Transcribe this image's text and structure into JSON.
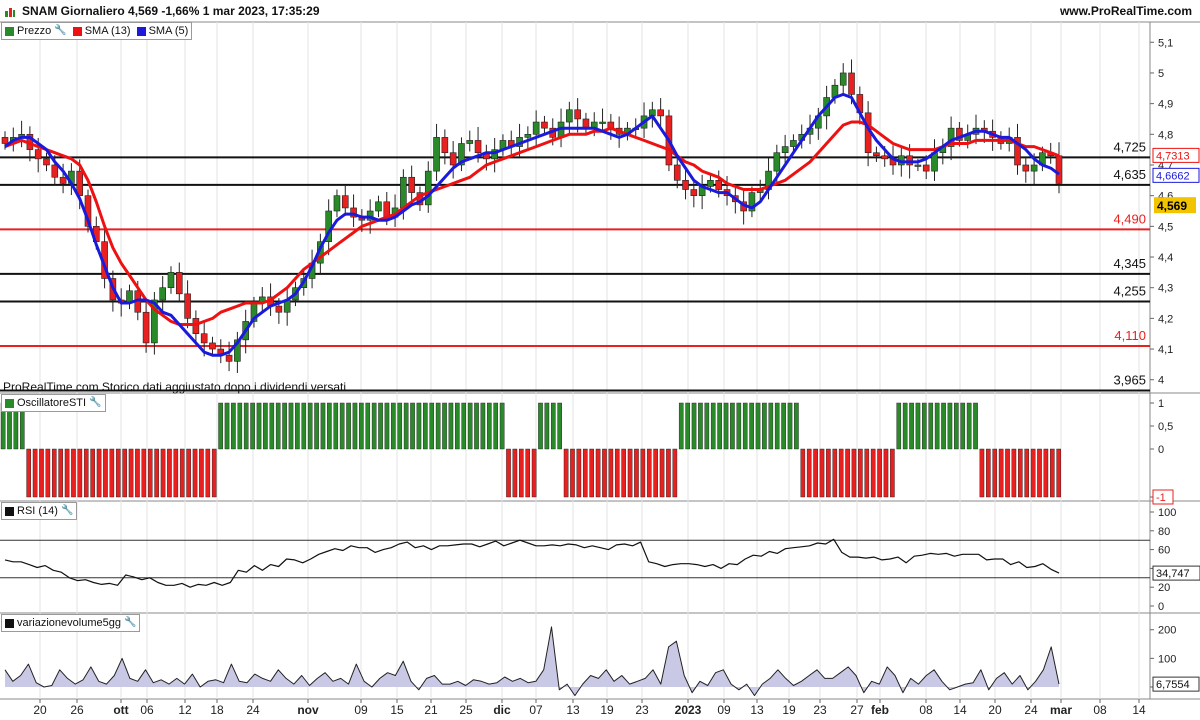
{
  "header": {
    "title": "SNAM Giornaliero 4,569 -1,66% 1 mar 2023, 17:35:29",
    "site": "www.ProRealTime.com"
  },
  "note": "ProRealTime.com Storico dati aggiustato dopo i dividendi versati",
  "legends": {
    "price": "Prezzo",
    "sma13": "SMA (13)",
    "sma5": "SMA (5)",
    "osc": "OscillatoreSTI",
    "rsi": "RSI (14)",
    "vol": "variazionevolume5gg"
  },
  "colors": {
    "up": "#2a8a2a",
    "down": "#e82020",
    "sma13": "#ee1111",
    "sma5": "#1a1adc",
    "volFill": "#c9c9e6"
  },
  "chart_data": [
    {
      "panel": "price",
      "type": "candlestick",
      "y_ticks": [
        "4",
        "4,1",
        "4,2",
        "4,3",
        "4,4",
        "4,5",
        "4,6",
        "4,7",
        "4,8",
        "4,9",
        "5",
        "5,1"
      ],
      "ylim": [
        3.96,
        5.14
      ],
      "x_ticks": [
        "20",
        "26",
        "ott",
        "06",
        "12",
        "18",
        "24",
        "nov",
        "09",
        "15",
        "21",
        "25",
        "dic",
        "07",
        "13",
        "19",
        "23",
        "2023",
        "09",
        "13",
        "19",
        "23",
        "27",
        "feb",
        "08",
        "14",
        "20",
        "24",
        "mar",
        "08",
        "14"
      ],
      "levels": [
        {
          "value": 4.725,
          "label": "4,725",
          "color": "black"
        },
        {
          "value": 4.635,
          "label": "4,635",
          "color": "black"
        },
        {
          "value": 4.49,
          "label": "4,490",
          "color": "red"
        },
        {
          "value": 4.345,
          "label": "4,345",
          "color": "black"
        },
        {
          "value": 4.255,
          "label": "4,255",
          "color": "black"
        },
        {
          "value": 4.11,
          "label": "4,110",
          "color": "red"
        },
        {
          "value": 3.965,
          "label": "3,965",
          "color": "black"
        }
      ],
      "last_values": [
        {
          "label": "4,7313",
          "value": 4.7313,
          "series": "sma13"
        },
        {
          "label": "4,6662",
          "value": 4.6662,
          "series": "sma5"
        },
        {
          "label": "4,569",
          "value": 4.569,
          "series": "price"
        }
      ],
      "close": [
        4.77,
        4.79,
        4.8,
        4.75,
        4.72,
        4.7,
        4.66,
        4.64,
        4.68,
        4.6,
        4.5,
        4.45,
        4.33,
        4.26,
        4.25,
        4.29,
        4.22,
        4.12,
        4.26,
        4.3,
        4.35,
        4.28,
        4.2,
        4.15,
        4.12,
        4.1,
        4.08,
        4.06,
        4.13,
        4.19,
        4.25,
        4.27,
        4.24,
        4.22,
        4.26,
        4.3,
        4.33,
        4.38,
        4.45,
        4.55,
        4.6,
        4.56,
        4.53,
        4.52,
        4.55,
        4.58,
        4.53,
        4.56,
        4.66,
        4.61,
        4.57,
        4.68,
        4.79,
        4.74,
        4.7,
        4.77,
        4.78,
        4.74,
        4.72,
        4.75,
        4.78,
        4.76,
        4.79,
        4.8,
        4.84,
        4.82,
        4.79,
        4.84,
        4.88,
        4.85,
        4.82,
        4.84,
        4.84,
        4.82,
        4.8,
        4.82,
        4.82,
        4.86,
        4.88,
        4.86,
        4.7,
        4.65,
        4.62,
        4.6,
        4.63,
        4.65,
        4.62,
        4.6,
        4.58,
        4.55,
        4.61,
        4.62,
        4.68,
        4.74,
        4.76,
        4.78,
        4.8,
        4.82,
        4.86,
        4.92,
        4.96,
        5.0,
        4.93,
        4.87,
        4.74,
        4.73,
        4.72,
        4.7,
        4.73,
        4.7,
        4.7,
        4.68,
        4.74,
        4.76,
        4.82,
        4.78,
        4.8,
        4.82,
        4.81,
        4.79,
        4.77,
        4.79,
        4.7,
        4.68,
        4.7,
        4.74,
        4.73,
        4.64
      ],
      "sma13": [
        4.76,
        4.77,
        4.78,
        4.77,
        4.76,
        4.75,
        4.74,
        4.73,
        4.72,
        4.7,
        4.65,
        4.58,
        4.5,
        4.43,
        4.38,
        4.34,
        4.3,
        4.26,
        4.23,
        4.21,
        4.19,
        4.18,
        4.18,
        4.18,
        4.19,
        4.2,
        4.22,
        4.23,
        4.24,
        4.25,
        4.25,
        4.25,
        4.26,
        4.28,
        4.3,
        4.33,
        4.36,
        4.38,
        4.4,
        4.42,
        4.44,
        4.46,
        4.48,
        4.5,
        4.51,
        4.52,
        4.53,
        4.54,
        4.56,
        4.58,
        4.6,
        4.61,
        4.62,
        4.63,
        4.64,
        4.65,
        4.66,
        4.68,
        4.7,
        4.71,
        4.72,
        4.73,
        4.74,
        4.75,
        4.76,
        4.77,
        4.78,
        4.79,
        4.8,
        4.8,
        4.8,
        4.81,
        4.81,
        4.82,
        4.81,
        4.8,
        4.79,
        4.78,
        4.77,
        4.76,
        4.75,
        4.73,
        4.71,
        4.7,
        4.68,
        4.67,
        4.66,
        4.64,
        4.63,
        4.62,
        4.62,
        4.62,
        4.63,
        4.64,
        4.65,
        4.67,
        4.69,
        4.71,
        4.74,
        4.77,
        4.8,
        4.83,
        4.84,
        4.84,
        4.83,
        4.81,
        4.79,
        4.77,
        4.76,
        4.75,
        4.75,
        4.75,
        4.75,
        4.76,
        4.77,
        4.77,
        4.77,
        4.78,
        4.78,
        4.78,
        4.78,
        4.78,
        4.77,
        4.76,
        4.76,
        4.75,
        4.74,
        4.73
      ],
      "sma5": [
        4.76,
        4.78,
        4.79,
        4.79,
        4.77,
        4.75,
        4.71,
        4.68,
        4.64,
        4.59,
        4.52,
        4.44,
        4.37,
        4.3,
        4.25,
        4.25,
        4.26,
        4.26,
        4.25,
        4.22,
        4.21,
        4.18,
        4.15,
        4.12,
        4.09,
        4.08,
        4.08,
        4.09,
        4.12,
        4.16,
        4.2,
        4.22,
        4.24,
        4.25,
        4.26,
        4.28,
        4.32,
        4.37,
        4.43,
        4.48,
        4.52,
        4.54,
        4.54,
        4.53,
        4.53,
        4.52,
        4.52,
        4.53,
        4.55,
        4.57,
        4.58,
        4.6,
        4.63,
        4.66,
        4.69,
        4.71,
        4.72,
        4.73,
        4.74,
        4.74,
        4.75,
        4.76,
        4.77,
        4.78,
        4.79,
        4.8,
        4.81,
        4.82,
        4.82,
        4.82,
        4.82,
        4.82,
        4.81,
        4.8,
        4.79,
        4.8,
        4.82,
        4.84,
        4.86,
        4.82,
        4.78,
        4.73,
        4.69,
        4.65,
        4.63,
        4.62,
        4.61,
        4.61,
        4.59,
        4.57,
        4.56,
        4.58,
        4.62,
        4.66,
        4.7,
        4.74,
        4.78,
        4.82,
        4.86,
        4.89,
        4.92,
        4.93,
        4.92,
        4.87,
        4.82,
        4.78,
        4.75,
        4.72,
        4.71,
        4.71,
        4.71,
        4.72,
        4.74,
        4.76,
        4.78,
        4.79,
        4.8,
        4.81,
        4.81,
        4.8,
        4.79,
        4.79,
        4.77,
        4.75,
        4.72,
        4.7,
        4.69,
        4.67
      ]
    },
    {
      "panel": "oscillator",
      "type": "bar",
      "y_ticks": [
        "1",
        "0,5",
        "0",
        "-1"
      ],
      "last_value_label": "-1",
      "ylim": [
        -1,
        1
      ],
      "values": [
        1,
        1,
        1,
        1,
        -1,
        -1,
        -1,
        -1,
        -1,
        -1,
        -1,
        -1,
        -1,
        -1,
        -1,
        -1,
        -1,
        -1,
        -1,
        -1,
        -1,
        -1,
        -1,
        -1,
        -1,
        -1,
        -1,
        -1,
        -1,
        -1,
        -1,
        -1,
        -1,
        -1,
        1,
        1,
        1,
        1,
        1,
        1,
        1,
        1,
        1,
        1,
        1,
        1,
        1,
        1,
        1,
        1,
        1,
        1,
        1,
        1,
        1,
        1,
        1,
        1,
        1,
        1,
        1,
        1,
        1,
        1,
        1,
        1,
        1,
        1,
        1,
        1,
        1,
        1,
        1,
        1,
        1,
        1,
        1,
        1,
        1,
        -1,
        -1,
        -1,
        -1,
        -1,
        1,
        1,
        1,
        1,
        -1,
        -1,
        -1,
        -1,
        -1,
        -1,
        -1,
        -1,
        -1,
        -1,
        -1,
        -1,
        -1,
        -1,
        -1,
        -1,
        -1,
        -1,
        1,
        1,
        1,
        1,
        1,
        1,
        1,
        1,
        1,
        1,
        1,
        1,
        1,
        1,
        1,
        1,
        1,
        1,
        1,
        -1,
        -1,
        -1,
        -1,
        -1,
        -1,
        -1,
        -1,
        -1,
        -1,
        -1,
        -1,
        -1,
        -1,
        -1,
        1,
        1,
        1,
        1,
        1,
        1,
        1,
        1,
        1,
        1,
        1,
        1,
        1,
        -1,
        -1,
        -1,
        -1,
        -1,
        -1,
        -1,
        -1,
        -1,
        -1,
        -1,
        -1,
        -1
      ]
    },
    {
      "panel": "rsi",
      "type": "line",
      "y_ticks": [
        "100",
        "80",
        "60",
        "40",
        "20",
        "0"
      ],
      "ylim": [
        0,
        100
      ],
      "levels": [
        70,
        30
      ],
      "last_value_label": "34,747",
      "values": [
        49,
        47,
        47,
        44,
        41,
        43,
        38,
        36,
        30,
        27,
        28,
        25,
        23,
        24,
        22,
        33,
        31,
        28,
        30,
        25,
        22,
        22,
        24,
        20,
        23,
        22,
        25,
        22,
        25,
        38,
        36,
        43,
        38,
        44,
        42,
        50,
        49,
        46,
        50,
        55,
        58,
        61,
        59,
        64,
        62,
        62,
        57,
        60,
        62,
        66,
        68,
        62,
        64,
        60,
        64,
        64,
        65,
        66,
        66,
        63,
        66,
        69,
        64,
        67,
        70,
        67,
        64,
        64,
        65,
        64,
        66,
        65,
        62,
        64,
        62,
        60,
        65,
        66,
        64,
        68,
        47,
        45,
        42,
        44,
        45,
        45,
        44,
        42,
        44,
        40,
        45,
        44,
        50,
        54,
        53,
        58,
        56,
        61,
        62,
        63,
        64,
        67,
        66,
        71,
        57,
        52,
        52,
        51,
        52,
        49,
        50,
        52,
        46,
        53,
        54,
        56,
        55,
        56,
        53,
        55,
        55,
        55,
        49,
        50,
        50,
        44,
        47,
        41,
        42,
        45,
        39,
        35
      ]
    },
    {
      "panel": "volume",
      "type": "area",
      "y_ticks": [
        "200",
        "100",
        "0"
      ],
      "ylim": [
        -35,
        220
      ],
      "last_value_label": "6,7554",
      "values": [
        60,
        20,
        40,
        80,
        15,
        0,
        5,
        60,
        30,
        10,
        25,
        70,
        20,
        10,
        40,
        100,
        30,
        20,
        60,
        15,
        25,
        10,
        30,
        10,
        45,
        0,
        20,
        25,
        15,
        80,
        20,
        15,
        45,
        30,
        20,
        60,
        30,
        10,
        40,
        5,
        30,
        50,
        20,
        30,
        10,
        80,
        20,
        0,
        30,
        50,
        40,
        90,
        20,
        -10,
        30,
        40,
        10,
        10,
        20,
        5,
        25,
        20,
        10,
        15,
        35,
        20,
        30,
        15,
        20,
        60,
        210,
        -10,
        10,
        -30,
        10,
        40,
        30,
        60,
        20,
        40,
        10,
        20,
        30,
        60,
        10,
        140,
        160,
        40,
        -20,
        20,
        5,
        50,
        60,
        10,
        -10,
        10,
        -30,
        10,
        30,
        60,
        30,
        5,
        20,
        40,
        60,
        30,
        30,
        50,
        70,
        40,
        -20,
        20,
        10,
        70,
        40,
        -20,
        30,
        10,
        40,
        60,
        20,
        -10,
        0,
        10,
        15,
        60,
        -10,
        30,
        50,
        10,
        40,
        -10,
        20,
        60,
        140,
        10
      ]
    }
  ]
}
